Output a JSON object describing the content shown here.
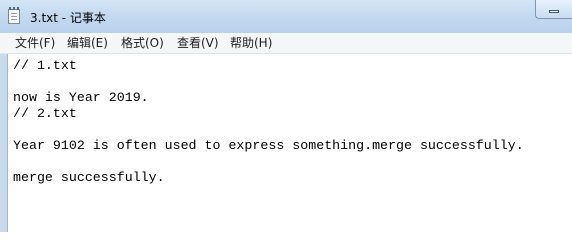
{
  "window": {
    "title": "3.txt - 记事本"
  },
  "menu": [
    {
      "label": "文件(F)"
    },
    {
      "label": "编辑(E)"
    },
    {
      "label": "格式(O)"
    },
    {
      "label": "查看(V)"
    },
    {
      "label": "帮助(H)"
    }
  ],
  "editor": {
    "lines": [
      "// 1.txt",
      "",
      "now is Year 2019.",
      "// 2.txt",
      "",
      "Year 9102 is often used to express something.merge successfully.",
      "",
      "merge successfully."
    ]
  },
  "icons": {
    "app": "notepad-icon",
    "minimize": "minimize-icon"
  }
}
